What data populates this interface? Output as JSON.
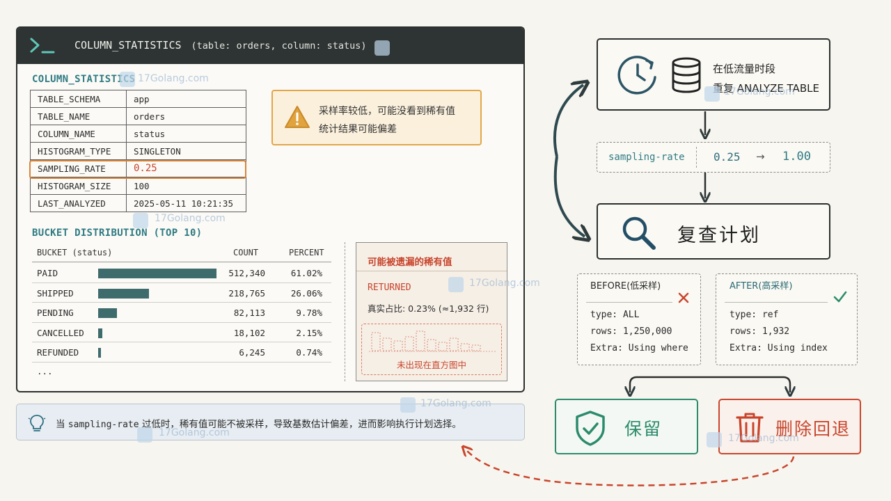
{
  "panel": {
    "title": "COLUMN_STATISTICS",
    "title_sub": "(table: orders, column: status)",
    "stats_title": "COLUMN_STATISTICS",
    "rows": [
      {
        "key": "TABLE_SCHEMA",
        "value": "app"
      },
      {
        "key": "TABLE_NAME",
        "value": "orders"
      },
      {
        "key": "COLUMN_NAME",
        "value": "status"
      },
      {
        "key": "HISTOGRAM_TYPE",
        "value": "SINGLETON"
      },
      {
        "key": "SAMPLING_RATE",
        "value": "0.25"
      },
      {
        "key": "HISTOGRAM_SIZE",
        "value": "100"
      },
      {
        "key": "LAST_ANALYZED",
        "value": "2025-05-11 10:21:35"
      }
    ],
    "warning_line1": "采样率较低，可能没看到稀有值",
    "warning_line2": "统计结果可能偏差",
    "bucket_title": "BUCKET DISTRIBUTION (TOP 10)",
    "bucket_headers": {
      "bucket": "BUCKET (status)",
      "count": "COUNT",
      "percent": "PERCENT"
    },
    "buckets": [
      {
        "name": "PAID",
        "count": "512,340",
        "percent": "61.02%",
        "share": 61.02
      },
      {
        "name": "SHIPPED",
        "count": "218,765",
        "percent": "26.06%",
        "share": 26.06
      },
      {
        "name": "PENDING",
        "count": "82,113",
        "percent": "9.78%",
        "share": 9.78
      },
      {
        "name": "CANCELLED",
        "count": "18,102",
        "percent": "2.15%",
        "share": 2.15
      },
      {
        "name": "REFUNDED",
        "count": "6,245",
        "percent": "0.74%",
        "share": 0.74
      }
    ],
    "ellipsis": "...",
    "missing_title": "可能被遗漏的稀有值",
    "missing_value": "RETURNED",
    "missing_ratio": "真实占比: 0.23% (≈1,932 行)",
    "missing_note": "未出现在直方图中"
  },
  "tip": {
    "prefix": "当",
    "code": "sampling-rate",
    "text": "过低时，稀有值可能不被采样，导致基数估计偏差，进而影响执行计划选择。"
  },
  "flow": {
    "step1_line1": "在低流量时段",
    "step1_line2": "重复 ANALYZE TABLE",
    "rate_label": "sampling-rate",
    "rate_from": "0.25",
    "rate_arrow": "→",
    "rate_to": "1.00",
    "recheck": "复查计划",
    "before": {
      "title": "BEFORE(低采样)",
      "type": "type: ALL",
      "rows": "rows: 1,250,000",
      "extra": "Extra: Using where"
    },
    "after": {
      "title": "AFTER(高采样)",
      "type": "type: ref",
      "rows": "rows: 1,932",
      "extra": "Extra: Using index"
    },
    "keep": "保留",
    "delete": "删除回退"
  },
  "watermark": {
    "site": "17Golang.com"
  },
  "colors": {
    "teal": "#2f7b83",
    "orange": "#d7843a",
    "red": "#c8452c",
    "green": "#2c8b6c",
    "dark": "#2b2f2f"
  }
}
